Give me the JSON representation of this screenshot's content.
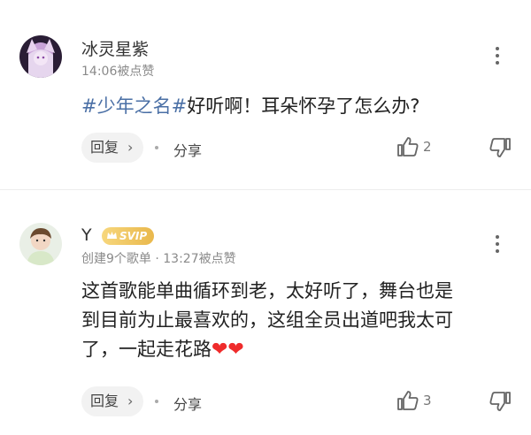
{
  "comments": [
    {
      "user": "冰灵星紫",
      "meta": "14:06被点赞",
      "hashtag": "#少年之名#",
      "text": "好听啊！耳朵怀孕了怎么办?",
      "reply_label": "回复",
      "share_label": "分享",
      "likes": "2",
      "icons": {
        "avatar": "anime-girl-avatar",
        "more": "more-vertical-icon",
        "like": "thumb-up-icon",
        "dislike": "thumb-down-icon"
      }
    },
    {
      "user": "Y",
      "badge": "SVIP",
      "meta": "创建9个歌单 · 13:27被点赞",
      "text_lines": [
        "这首歌能单曲循环到老，太好听了，舞台也是",
        "到目前为止最喜欢的，这组全员出道吧我太可",
        "了，一起走花路"
      ],
      "emoji": "❤❤",
      "reply_label": "回复",
      "share_label": "分享",
      "likes": "3",
      "icons": {
        "avatar": "boy-photo-avatar",
        "more": "more-vertical-icon",
        "like": "thumb-up-icon",
        "dislike": "thumb-down-icon",
        "badge": "crown-icon"
      }
    }
  ],
  "colors": {
    "hashtag": "#4a6fa5",
    "heart": "#ef2b2b",
    "svip_gold": "#e9b84c"
  }
}
